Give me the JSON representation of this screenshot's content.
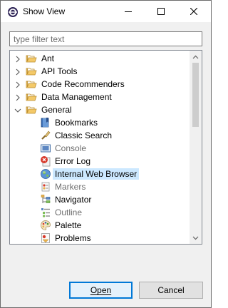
{
  "window": {
    "title": "Show View",
    "icon": "eclipse-view-icon"
  },
  "filter": {
    "placeholder": "type filter text",
    "value": ""
  },
  "tree": {
    "categories": [
      {
        "label": "Ant",
        "expanded": false
      },
      {
        "label": "API Tools",
        "expanded": false
      },
      {
        "label": "Code Recommenders",
        "expanded": false
      },
      {
        "label": "Data Management",
        "expanded": false
      },
      {
        "label": "General",
        "expanded": true
      }
    ],
    "general_items": [
      {
        "label": "Bookmarks",
        "icon": "bookmarks-icon",
        "disabled": false,
        "selected": false
      },
      {
        "label": "Classic Search",
        "icon": "classic-search-icon",
        "disabled": false,
        "selected": false
      },
      {
        "label": "Console",
        "icon": "console-icon",
        "disabled": true,
        "selected": false
      },
      {
        "label": "Error Log",
        "icon": "error-log-icon",
        "disabled": false,
        "selected": false
      },
      {
        "label": "Internal Web Browser",
        "icon": "globe-icon",
        "disabled": false,
        "selected": true
      },
      {
        "label": "Markers",
        "icon": "markers-icon",
        "disabled": true,
        "selected": false
      },
      {
        "label": "Navigator",
        "icon": "navigator-icon",
        "disabled": false,
        "selected": false
      },
      {
        "label": "Outline",
        "icon": "outline-icon",
        "disabled": true,
        "selected": false
      },
      {
        "label": "Palette",
        "icon": "palette-icon",
        "disabled": false,
        "selected": false
      },
      {
        "label": "Problems",
        "icon": "problems-icon",
        "disabled": false,
        "selected": false
      }
    ]
  },
  "buttons": {
    "open": "Open",
    "cancel": "Cancel"
  },
  "colors": {
    "selection": "#cce8ff",
    "default_button_border": "#0078d7",
    "folder": "#e8b04c"
  }
}
